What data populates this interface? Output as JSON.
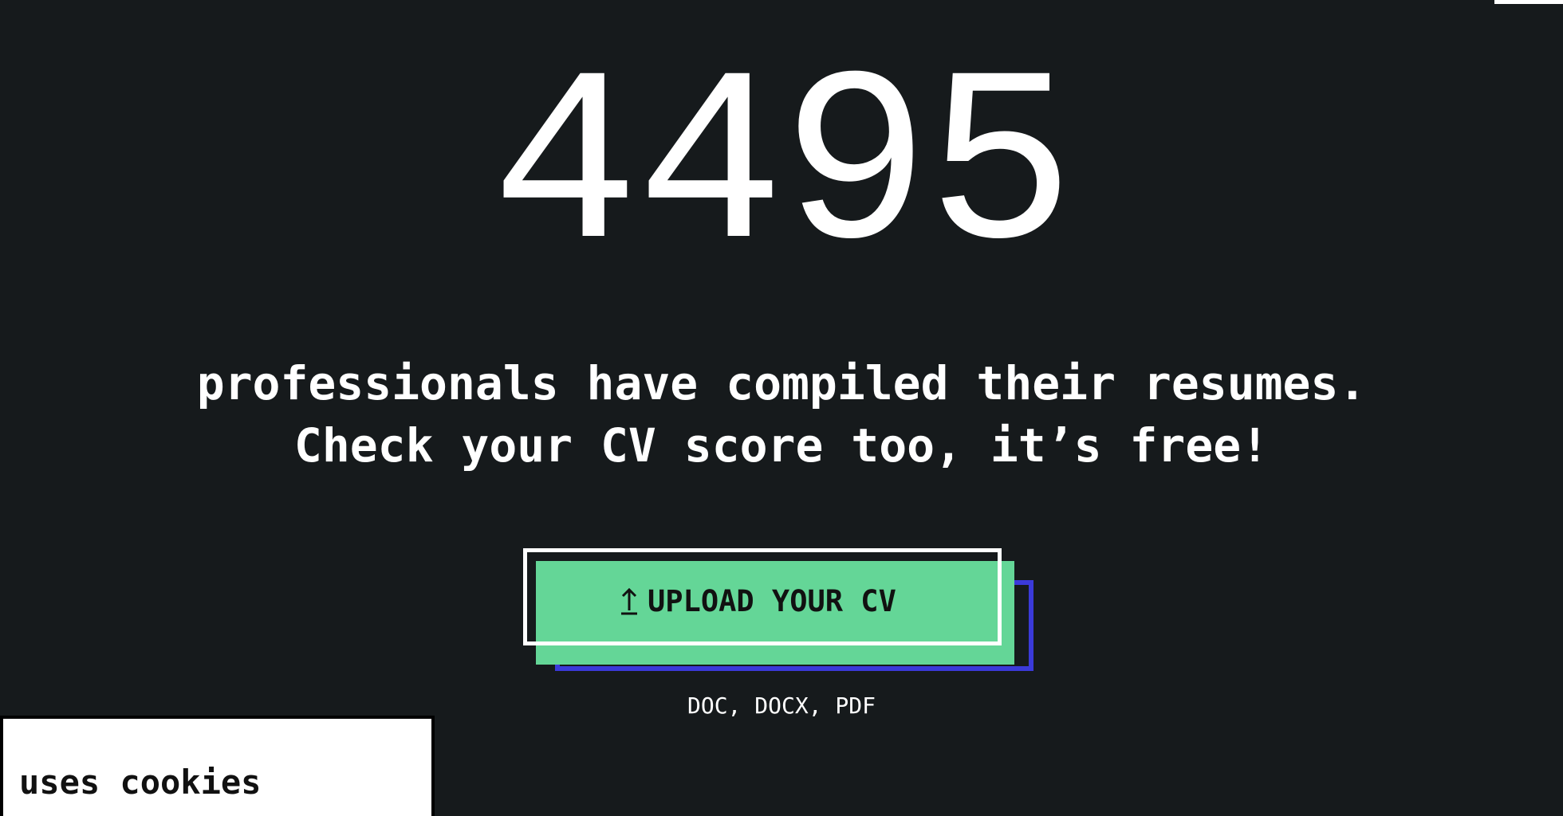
{
  "hero": {
    "count": "4495",
    "line1": "professionals have compiled their resumes.",
    "line2": "Check your CV score too, it’s free!"
  },
  "upload": {
    "icon": "upload-arrow-icon",
    "label": "UPLOAD YOUR CV",
    "formats": "DOC, DOCX, PDF"
  },
  "cookie_banner": {
    "text": "uses cookies"
  },
  "colors": {
    "background": "#161a1c",
    "button_fill": "#64d697",
    "button_shadow": "#3b3ad9",
    "text": "#ffffff"
  }
}
